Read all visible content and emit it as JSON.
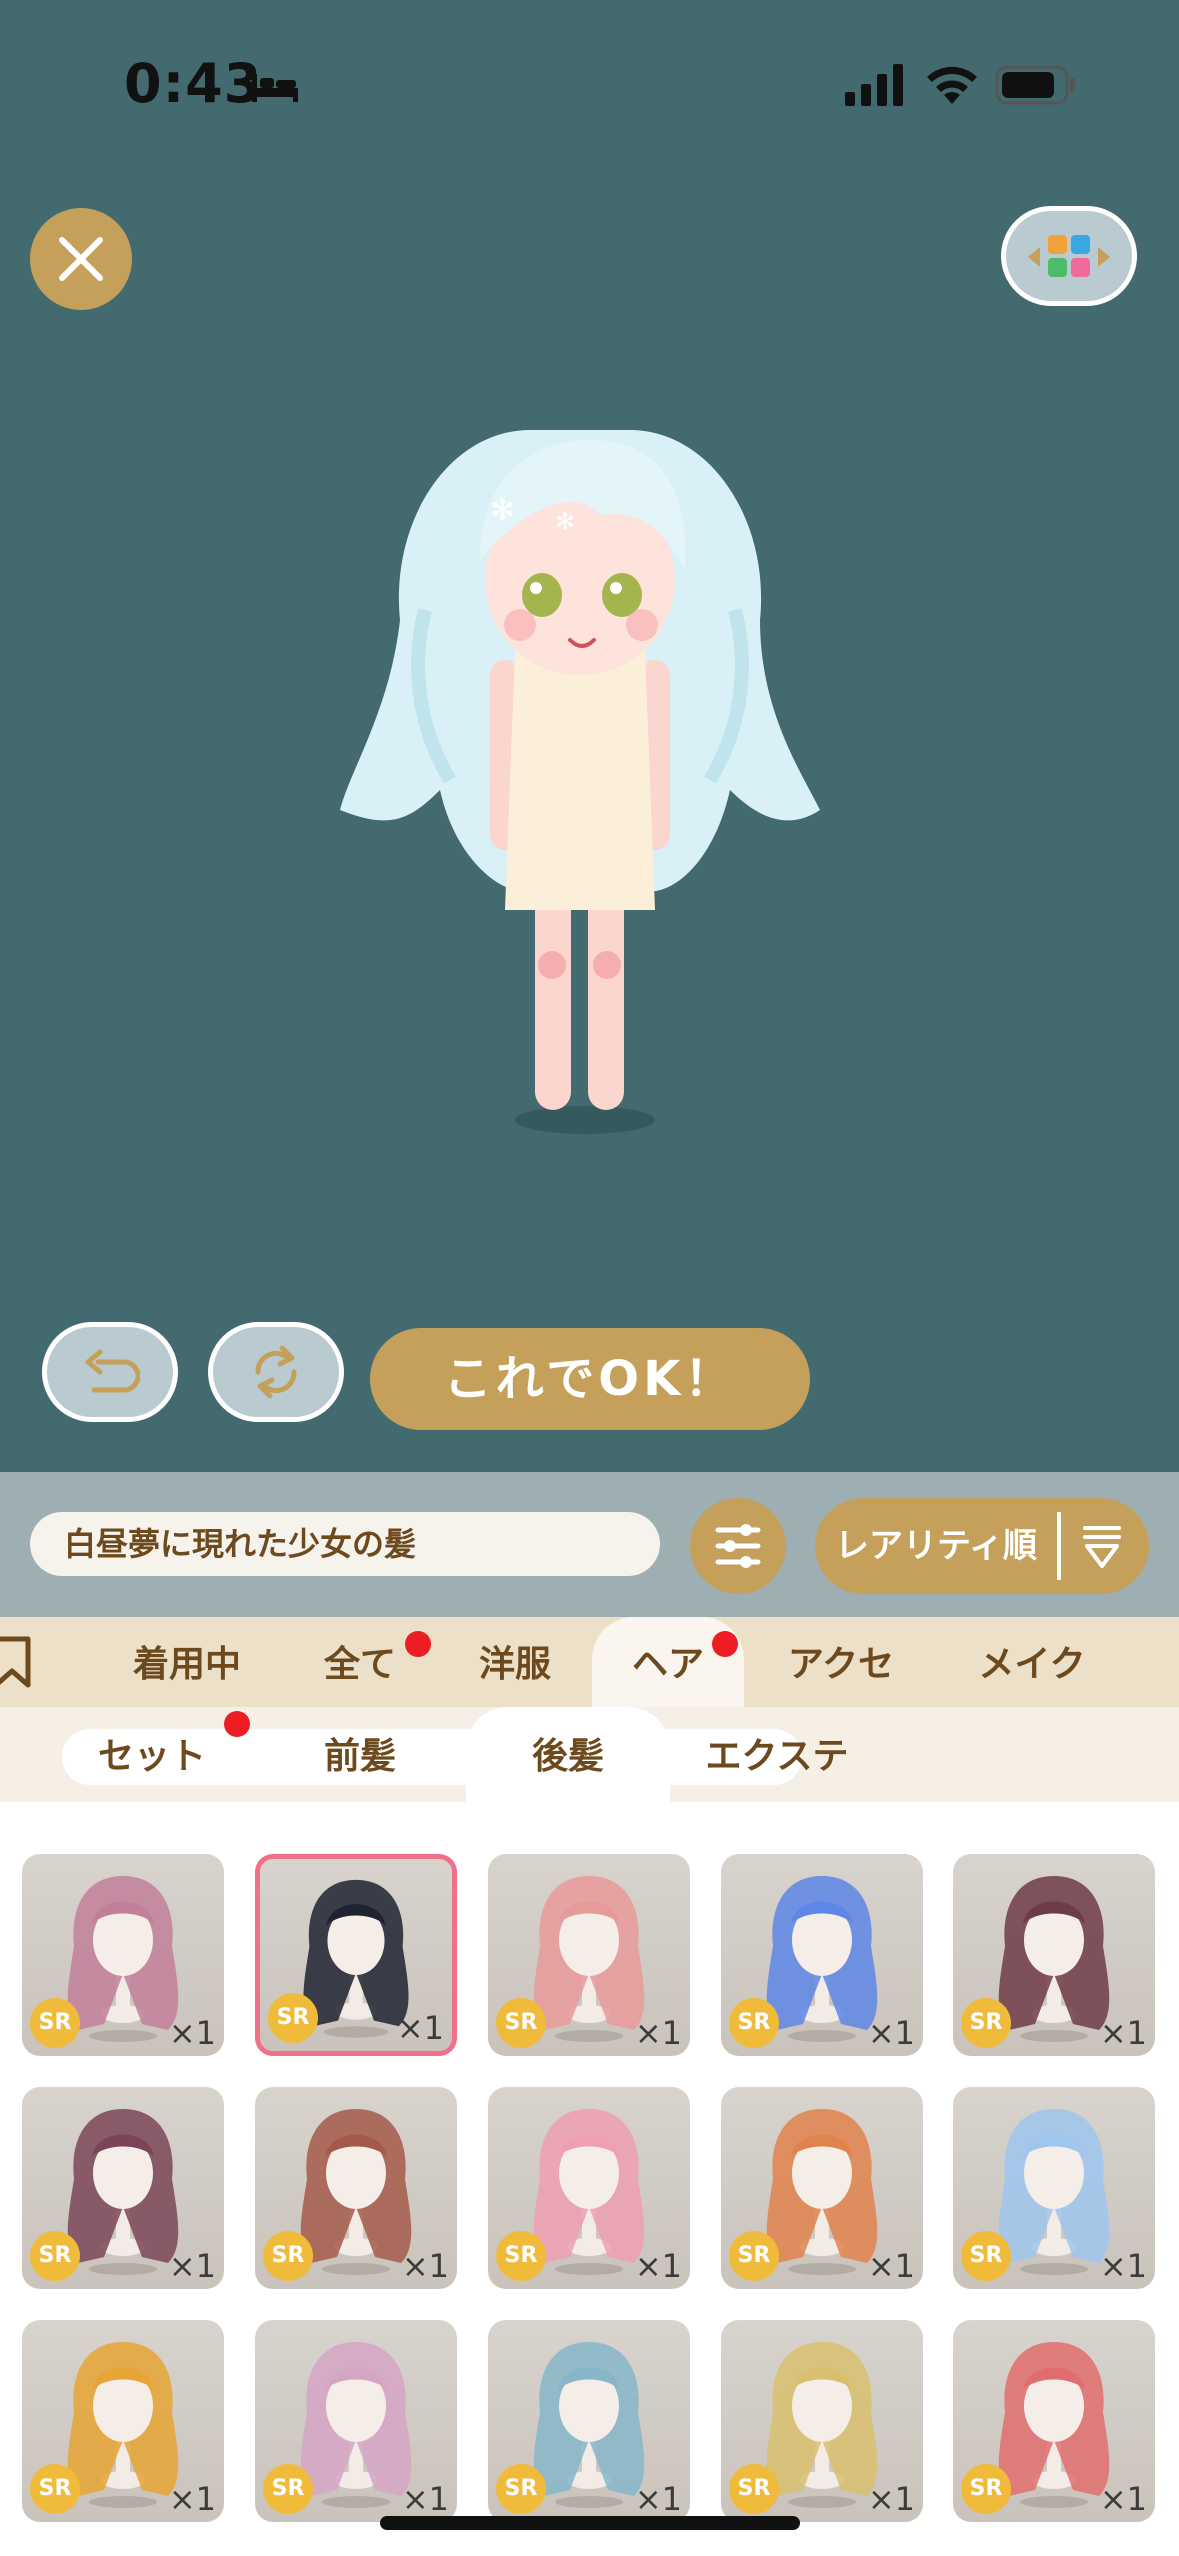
{
  "status_bar": {
    "time": "0:43"
  },
  "actions": {
    "ok_label": "これでOK！"
  },
  "name_bar": {
    "item_name": "白昼夢に現れた少女の髪",
    "sort_label": "レアリティ順"
  },
  "category_tabs": [
    {
      "label": "着用中",
      "badge": false
    },
    {
      "label": "全て",
      "badge": true
    },
    {
      "label": "洋服",
      "badge": false
    },
    {
      "label": "ヘア",
      "badge": true,
      "active": true
    },
    {
      "label": "アクセ",
      "badge": false
    },
    {
      "label": "メイク",
      "badge": false
    }
  ],
  "sub_tabs": [
    {
      "label": "セット",
      "badge": true
    },
    {
      "label": "前髪",
      "badge": false
    },
    {
      "label": "後髪",
      "badge": false,
      "active": true
    },
    {
      "label": "エクステ",
      "badge": false
    }
  ],
  "items": [
    {
      "rarity": "SR",
      "qty": "×1",
      "hair_color": "#c27f9a",
      "selected": false
    },
    {
      "rarity": "SR",
      "qty": "×1",
      "hair_color": "#1f2230",
      "selected": true
    },
    {
      "rarity": "SR",
      "qty": "×1",
      "hair_color": "#e79a9a",
      "selected": false
    },
    {
      "rarity": "SR",
      "qty": "×1",
      "hair_color": "#5d86e6",
      "selected": false
    },
    {
      "rarity": "SR",
      "qty": "×1",
      "hair_color": "#6e3b48",
      "selected": false
    },
    {
      "rarity": "SR",
      "qty": "×1",
      "hair_color": "#7b4557",
      "selected": false
    },
    {
      "rarity": "SR",
      "qty": "×1",
      "hair_color": "#a45a4a",
      "selected": false
    },
    {
      "rarity": "SR",
      "qty": "×1",
      "hair_color": "#ef9fb0",
      "selected": false
    },
    {
      "rarity": "SR",
      "qty": "×1",
      "hair_color": "#e0834c",
      "selected": false
    },
    {
      "rarity": "SR",
      "qty": "×1",
      "hair_color": "#9fc6ee",
      "selected": false
    },
    {
      "rarity": "SR",
      "qty": "×1",
      "hair_color": "#e6a534",
      "selected": false
    },
    {
      "rarity": "SR",
      "qty": "×1",
      "hair_color": "#d5a5c4",
      "selected": false
    },
    {
      "rarity": "SR",
      "qty": "×1",
      "hair_color": "#86b6c8",
      "selected": false
    },
    {
      "rarity": "SR",
      "qty": "×1",
      "hair_color": "#d8c06e",
      "selected": false
    },
    {
      "rarity": "SR",
      "qty": "×1",
      "hair_color": "#e06e6e",
      "selected": false
    }
  ]
}
